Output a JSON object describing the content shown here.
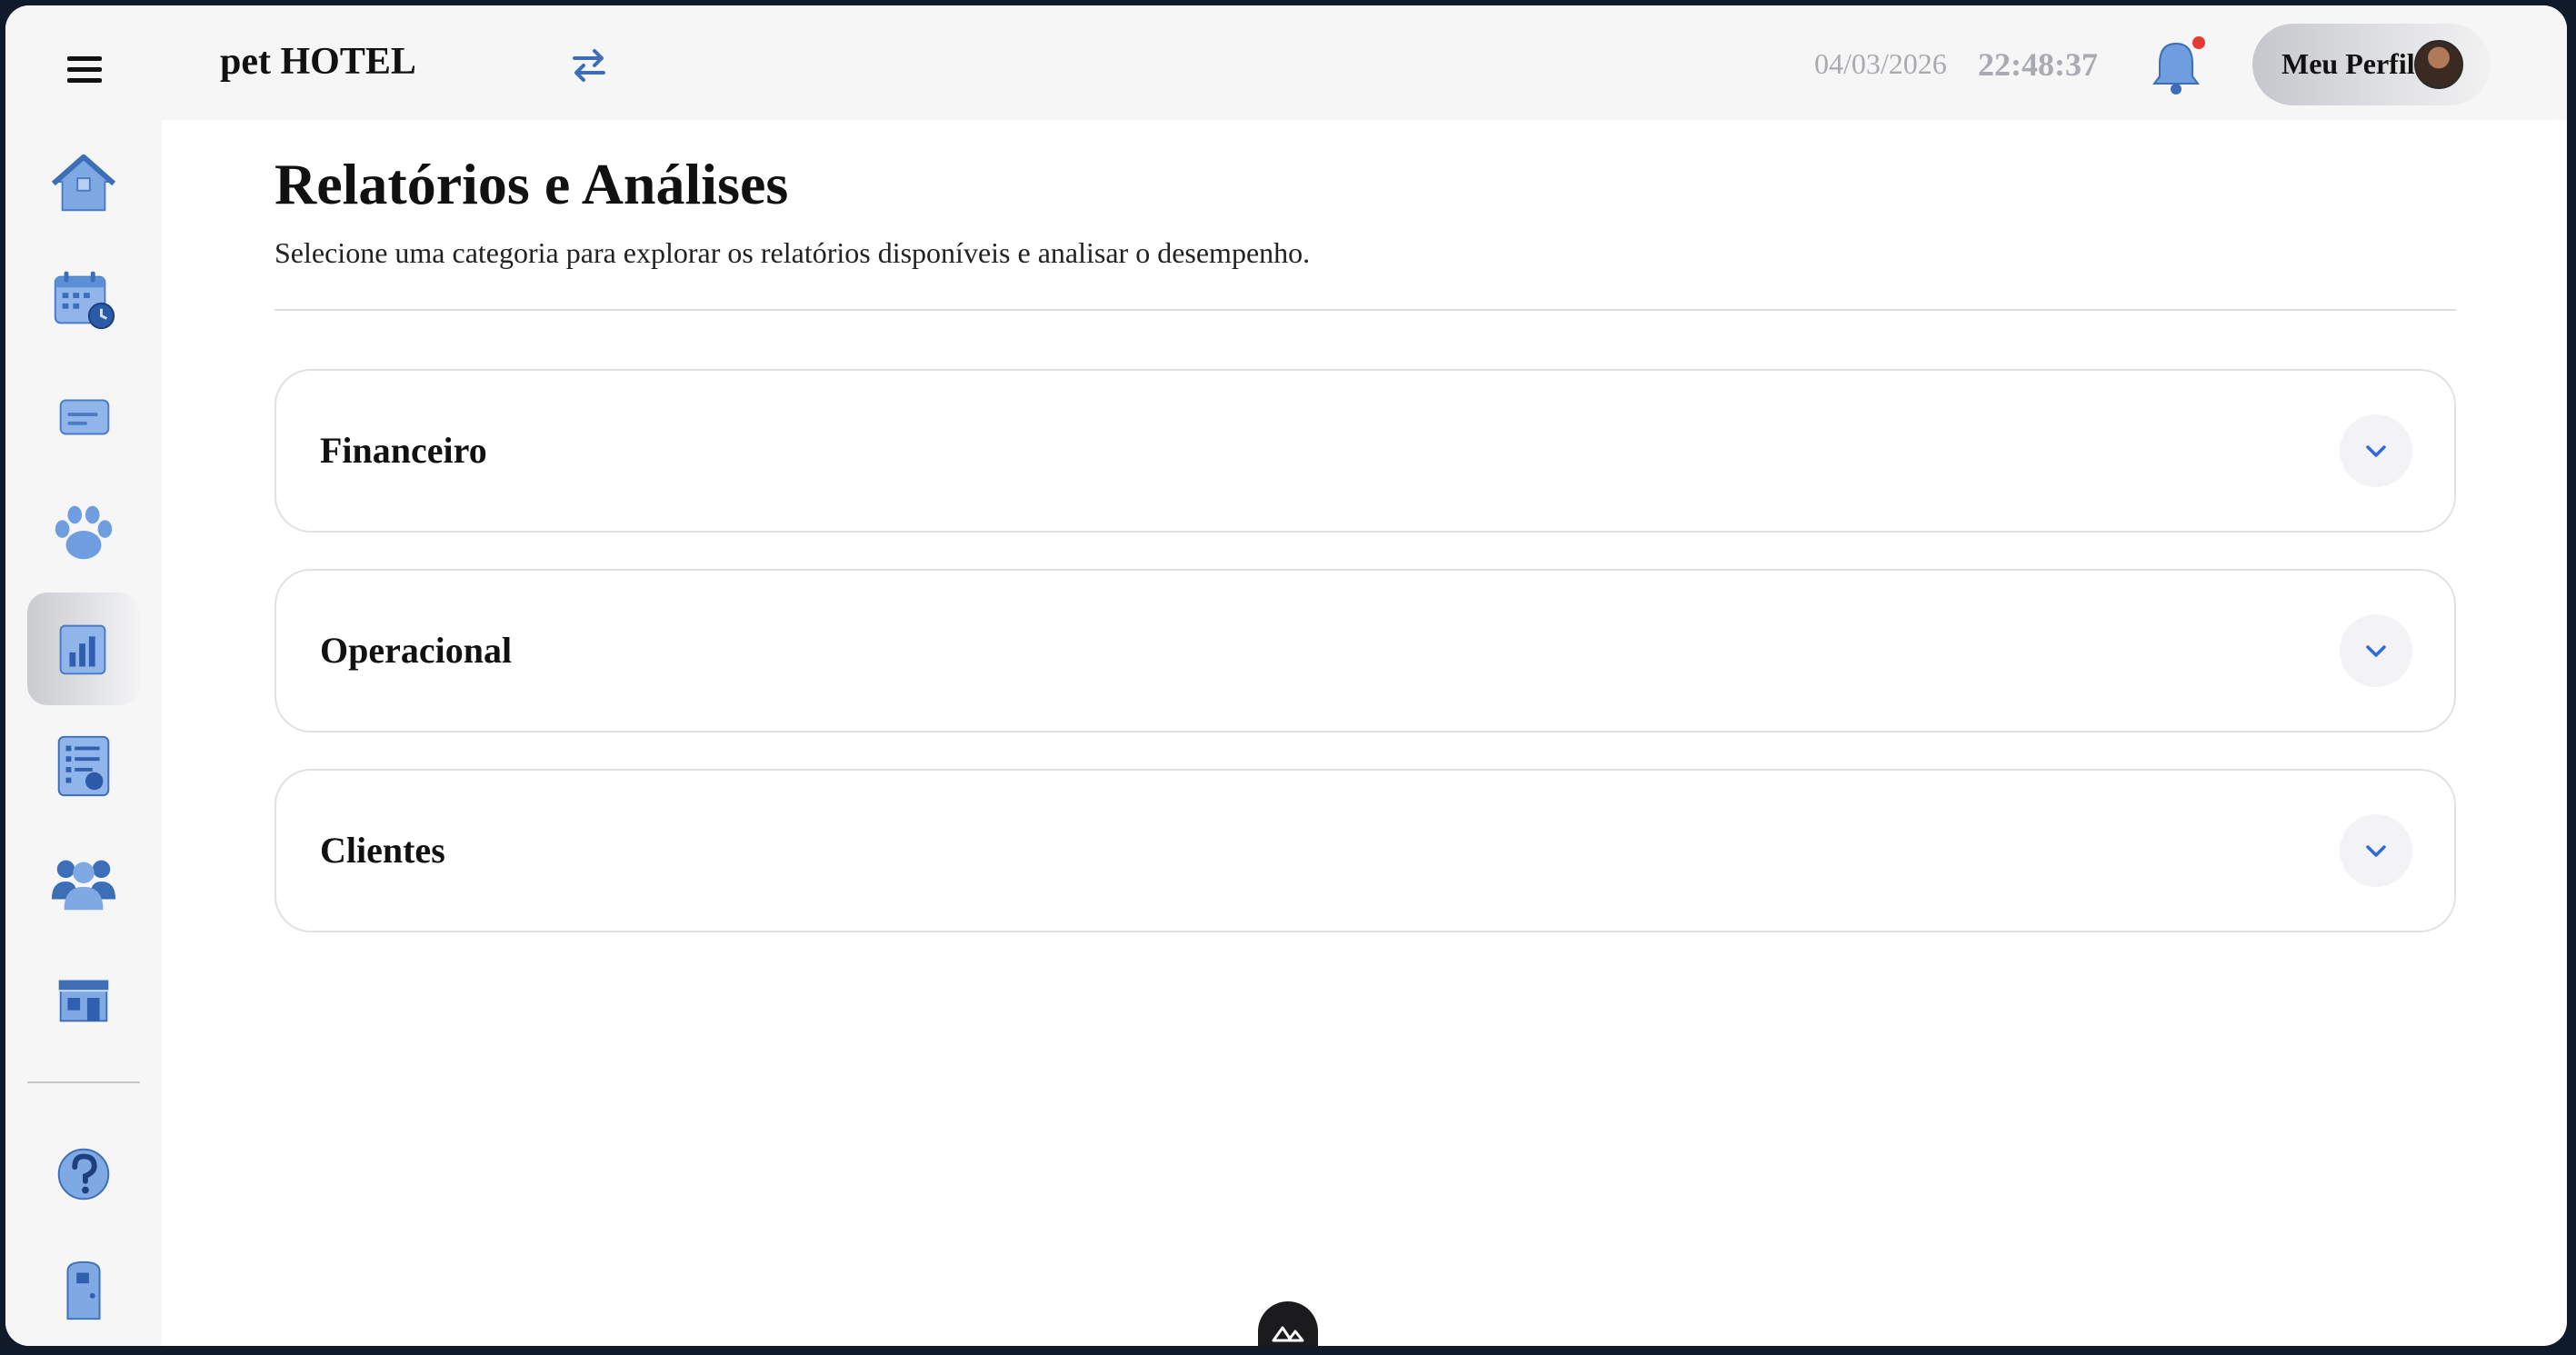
{
  "header": {
    "brand": "pet HOTEL",
    "date": "04/03/2026",
    "time": "22:48:37",
    "profile_label": "Meu Perfil",
    "icons": [
      "menu-icon",
      "swap-icon",
      "bell-icon",
      "avatar"
    ]
  },
  "sidebar": {
    "items": [
      {
        "name": "home",
        "icon": "house-icon",
        "active": false
      },
      {
        "name": "calendar",
        "icon": "calendar-clock-icon",
        "active": false
      },
      {
        "name": "card",
        "icon": "card-icon",
        "active": false
      },
      {
        "name": "pets",
        "icon": "paw-icon",
        "active": false
      },
      {
        "name": "reports",
        "icon": "report-chart-icon",
        "active": true
      },
      {
        "name": "checklist",
        "icon": "checklist-icon",
        "active": false
      },
      {
        "name": "users",
        "icon": "users-icon",
        "active": false
      },
      {
        "name": "store",
        "icon": "store-icon",
        "active": false
      },
      {
        "name": "help",
        "icon": "help-icon",
        "active": false
      },
      {
        "name": "logout",
        "icon": "door-icon",
        "active": false
      }
    ]
  },
  "main": {
    "title": "Relatórios e Análises",
    "subtitle": "Selecione uma categoria para explorar os relatórios disponíveis e analisar o desempenho.",
    "categories": [
      {
        "label": "Financeiro"
      },
      {
        "label": "Operacional"
      },
      {
        "label": "Clientes"
      }
    ]
  },
  "colors": {
    "accent": "#2f6bd8",
    "icon_blue": "#5b8fd6",
    "muted_text": "#a9abb0",
    "notification_dot": "#e53935"
  }
}
